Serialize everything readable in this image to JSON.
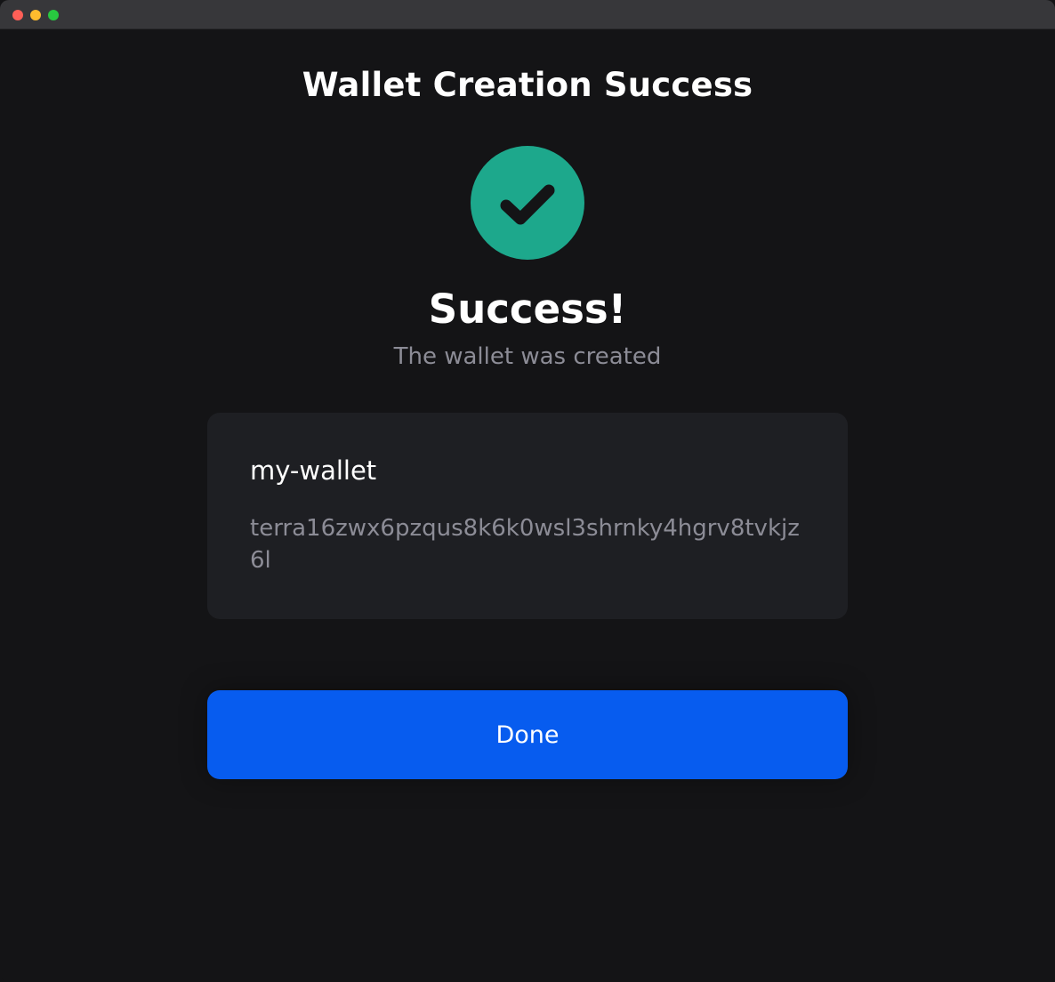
{
  "window": {
    "controls": [
      "close",
      "minimize",
      "zoom"
    ]
  },
  "header": {
    "title": "Wallet Creation Success"
  },
  "status": {
    "icon": "check-circle-icon",
    "icon_color": "#1da88c",
    "heading": "Success!",
    "message": "The wallet was created"
  },
  "wallet": {
    "name": "my-wallet",
    "address": "terra16zwx6pzqus8k6k0wsl3shrnky4hgrv8tvkjz6l"
  },
  "actions": {
    "done_label": "Done",
    "done_color": "#075cef"
  }
}
